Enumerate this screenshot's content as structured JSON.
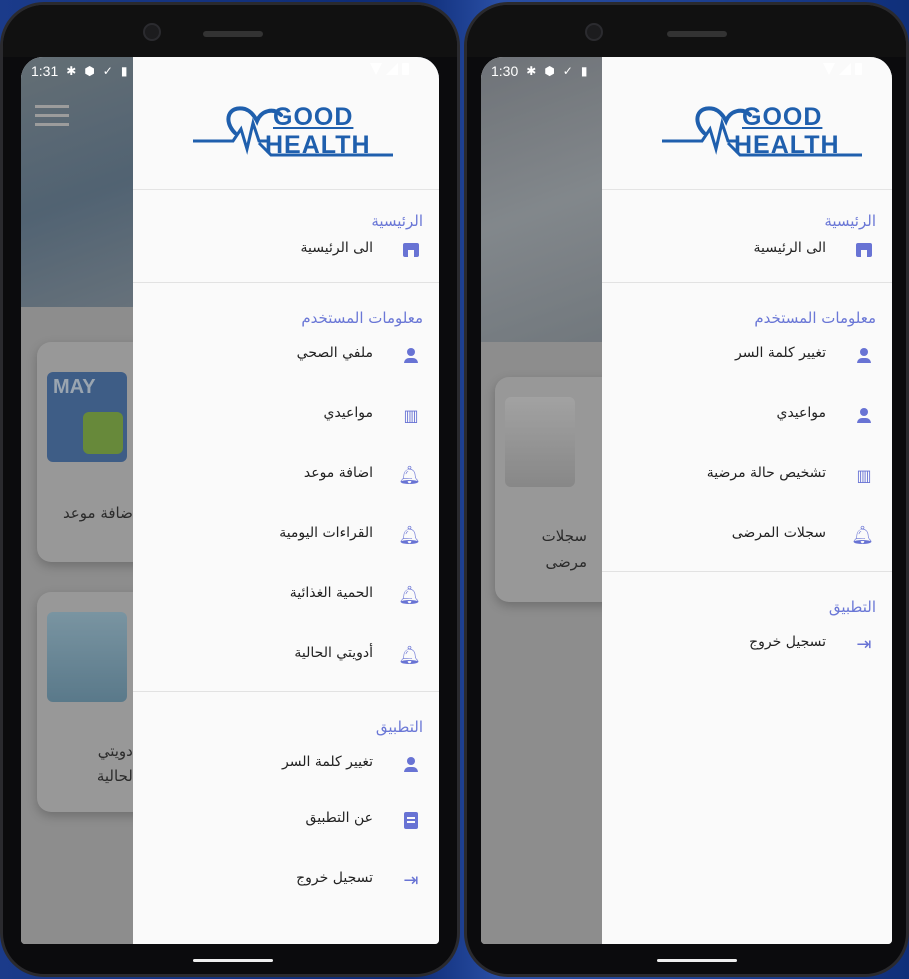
{
  "left_phone": {
    "status_time": "1:31",
    "background": {
      "card1_caption": "اضافة موعد",
      "card1_thumb_text": "MAY",
      "card2_caption_line1": "أدويتي",
      "card2_caption_line2": "الحالية"
    },
    "drawer": {
      "logo": {
        "line1": "GOOD",
        "line2": "HEALTH"
      },
      "sections": [
        {
          "title": "الرئيسية",
          "items": [
            {
              "label": "الى الرئيسية",
              "icon": "store-icon"
            }
          ]
        },
        {
          "title": "معلومات المستخدم",
          "items": [
            {
              "label": "ملفي الصحي",
              "icon": "person-icon"
            },
            {
              "label": "مواعيدي",
              "icon": "add-chart-icon"
            },
            {
              "label": "اضافة موعد",
              "icon": "bell-alert-icon"
            },
            {
              "label": "القراءات اليومية",
              "icon": "bell-alert-icon"
            },
            {
              "label": "الحمية الغذائية",
              "icon": "bell-alert-icon"
            },
            {
              "label": "أدويتي الحالية",
              "icon": "bell-alert-icon"
            }
          ]
        },
        {
          "title": "التطبيق",
          "items": [
            {
              "label": "تغيير كلمة السر",
              "icon": "person-icon"
            },
            {
              "label": "عن التطبيق",
              "icon": "clipboard-icon"
            },
            {
              "label": "تسجيل خروج",
              "icon": "logout-icon"
            }
          ]
        }
      ]
    }
  },
  "right_phone": {
    "status_time": "1:30",
    "background": {
      "card1_caption_line1": "سجلات",
      "card1_caption_line2": "مرضى"
    },
    "drawer": {
      "logo": {
        "line1": "GOOD",
        "line2": "HEALTH"
      },
      "sections": [
        {
          "title": "الرئيسية",
          "items": [
            {
              "label": "الى الرئيسية",
              "icon": "store-icon"
            }
          ]
        },
        {
          "title": "معلومات المستخدم",
          "items": [
            {
              "label": "تغيير كلمة السر",
              "icon": "person-icon"
            },
            {
              "label": "مواعيدي",
              "icon": "person-icon"
            },
            {
              "label": "تشخيص حالة مرضية",
              "icon": "add-chart-icon"
            },
            {
              "label": "سجلات المرضى",
              "icon": "bell-alert-icon"
            }
          ]
        },
        {
          "title": "التطبيق",
          "items": [
            {
              "label": "تسجيل خروج",
              "icon": "logout-icon"
            }
          ]
        }
      ]
    }
  },
  "colors": {
    "accent": "#6873d4",
    "logo_blue": "#1f5fad",
    "drawer_bg": "#fafafa"
  }
}
